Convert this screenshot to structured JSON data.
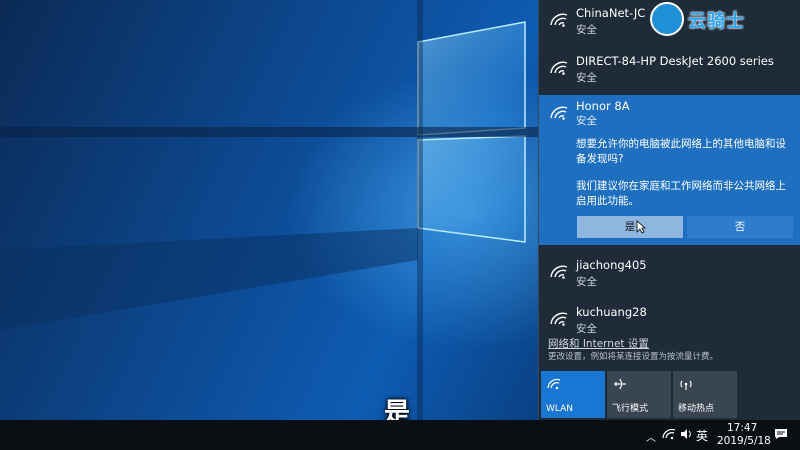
{
  "networks": [
    {
      "ssid": "ChinaNet-JC",
      "security": "安全"
    },
    {
      "ssid": "DIRECT-84-HP DeskJet 2600 series",
      "security": "安全"
    }
  ],
  "selected_network": {
    "ssid": "Honor 8A",
    "security": "安全",
    "prompt_line1": "想要允许你的电脑被此网络上的其他电脑和设备发现吗?",
    "prompt_line2": "我们建议你在家庭和工作网络而非公共网络上启用此功能。",
    "yes_label": "是",
    "no_label": "否"
  },
  "other_networks": [
    {
      "ssid": "jiachong405",
      "security": "安全"
    },
    {
      "ssid": "kuchuang28",
      "security": "安全"
    }
  ],
  "settings": {
    "link": "网络和 Internet 设置",
    "desc": "更改设置，例如将某连接设置为按流量计费。"
  },
  "quick_actions": {
    "wlan": "WLAN",
    "airplane": "飞行模式",
    "hotspot": "移动热点"
  },
  "watermark": {
    "text": "云骑士"
  },
  "caption": "是",
  "taskbar": {
    "ime": "英",
    "time": "17:47",
    "date": "2019/5/18"
  },
  "colors": {
    "accent": "#1e6fbf",
    "flyout_bg": "#1f2b38",
    "wlan_tile": "#1976d2",
    "taskbar_bg": "#0b0f14"
  }
}
